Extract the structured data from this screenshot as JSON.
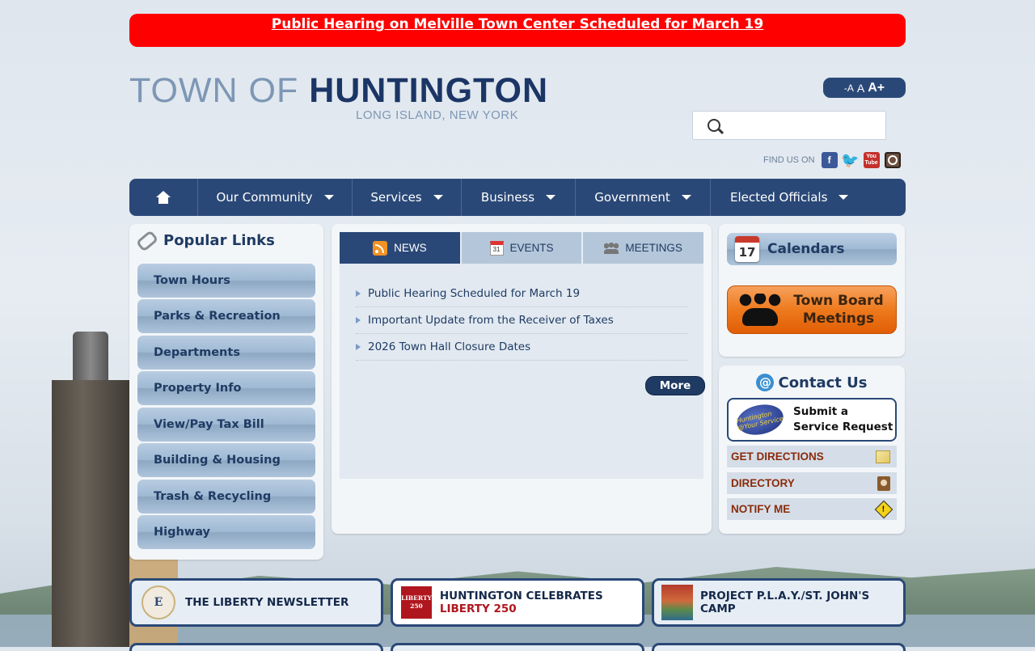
{
  "alert": {
    "text": "Public Hearing on Melville Town Center Scheduled for March 19"
  },
  "logo": {
    "line1": "TOWN OF ",
    "line2": "HUNTINGTON",
    "subtitle": "LONG ISLAND, NEW YORK"
  },
  "text_size": {
    "small": "-A",
    "medium": "A",
    "large": "A+"
  },
  "search": {
    "placeholder": "",
    "value": ""
  },
  "social": {
    "label": "FIND US ON",
    "icons": [
      "facebook-icon",
      "twitter-icon",
      "youtube-icon",
      "instagram-icon"
    ]
  },
  "nav": {
    "items": [
      {
        "label": "Our Community"
      },
      {
        "label": "Services"
      },
      {
        "label": "Business"
      },
      {
        "label": "Government"
      },
      {
        "label": "Elected Officials"
      }
    ]
  },
  "popular": {
    "title": "Popular Links",
    "links": [
      "Town Hours",
      "Parks & Recreation",
      "Departments",
      "Property Info",
      "View/Pay Tax Bill",
      "Building & Housing",
      "Trash & Recycling",
      "Highway"
    ]
  },
  "news": {
    "tabs": [
      {
        "label": "NEWS",
        "icon": "rss-icon",
        "active": true
      },
      {
        "label": "EVENTS",
        "icon": "calendar-icon",
        "active": false
      },
      {
        "label": "MEETINGS",
        "icon": "people-icon",
        "active": false
      }
    ],
    "calendar_icon_day": "31",
    "items": [
      "Public Hearing Scheduled for March 19",
      "Important Update from the Receiver of Taxes",
      "2026 Town Hall Closure Dates"
    ],
    "more_label": "More"
  },
  "calendars": {
    "title": "Calendars",
    "icon_day": "17",
    "town_board": "Town Board\nMeetings"
  },
  "contact": {
    "title": "Contact Us",
    "service_request": "Submit a\nService Request",
    "service_logo_text": "Huntington @Your Service",
    "buttons": [
      {
        "label": "GET DIRECTIONS",
        "icon": "map-icon"
      },
      {
        "label": "DIRECTORY",
        "icon": "directory-book-icon"
      },
      {
        "label": "NOTIFY ME",
        "icon": "warning-icon"
      }
    ]
  },
  "features": [
    {
      "label": "THE LIBERTY NEWSLETTER",
      "icon_text": "E"
    },
    {
      "label_prefix": "HUNTINGTON CELEBRATES ",
      "label_accent": "LIBERTY 250",
      "icon_text_1": "LIBERTY",
      "icon_text_2": "250"
    },
    {
      "label": "PROJECT P.L.A.Y./ST. JOHN'S CAMP"
    }
  ],
  "colors": {
    "alert": "#ff0000",
    "navy": "#2a4877",
    "orange": "#ee7a1d"
  }
}
